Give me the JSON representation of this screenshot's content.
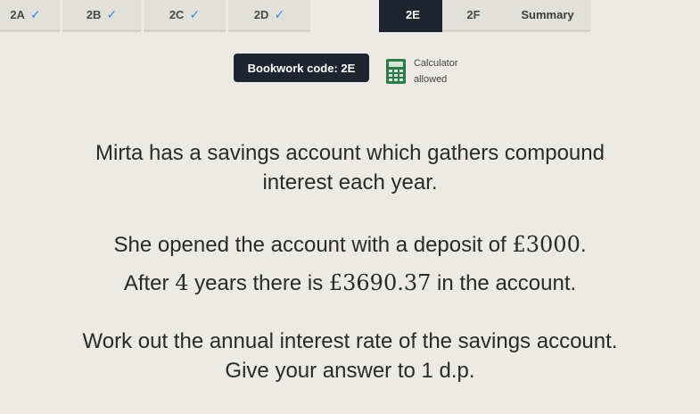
{
  "tabs": [
    {
      "label": "2A",
      "checked": true
    },
    {
      "label": "2B",
      "checked": true
    },
    {
      "label": "2C",
      "checked": true
    },
    {
      "label": "2D",
      "checked": true
    },
    {
      "label": "2E",
      "checked": false,
      "active": true
    },
    {
      "label": "2F",
      "checked": false
    },
    {
      "label": "Summary",
      "checked": false
    }
  ],
  "bookwork": {
    "label": "Bookwork code: 2E"
  },
  "calculator": {
    "line1": "Calculator",
    "line2": "allowed"
  },
  "question": {
    "line1": "Mirta has a savings account which gathers compound",
    "line2": "interest each year.",
    "line3": {
      "before": "She opened the account with a deposit of ",
      "value": "£3000",
      "after": "."
    },
    "line4": {
      "before": "After ",
      "years": "4",
      "middle": " years there is ",
      "value": "£3690.37",
      "after": " in the account."
    },
    "line5": "Work out the annual interest rate of the savings account.",
    "line6": "Give your answer to 1 d.p."
  },
  "colors": {
    "active_tab": "#1f2430",
    "tick": "#4a7fd0",
    "background": "#eceae4"
  }
}
